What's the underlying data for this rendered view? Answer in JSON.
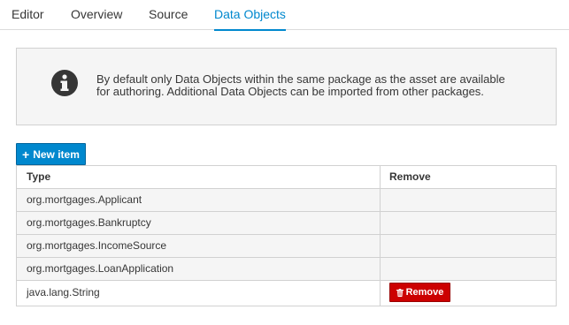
{
  "tabs": [
    {
      "label": "Editor",
      "active": false
    },
    {
      "label": "Overview",
      "active": false
    },
    {
      "label": "Source",
      "active": false
    },
    {
      "label": "Data Objects",
      "active": true
    }
  ],
  "info": {
    "icon": "info-circle-icon",
    "text_line1": "By default only Data Objects within the same package as the asset are available",
    "text_line2": "for authoring. Additional Data Objects can be imported from other packages."
  },
  "new_item_button": {
    "label": "New item",
    "icon": "plus-icon"
  },
  "table": {
    "columns": [
      "Type",
      "Remove"
    ],
    "rows": [
      {
        "type": "org.mortgages.Applicant",
        "removable": false
      },
      {
        "type": "org.mortgages.Bankruptcy",
        "removable": false
      },
      {
        "type": "org.mortgages.IncomeSource",
        "removable": false
      },
      {
        "type": "org.mortgages.LoanApplication",
        "removable": false
      },
      {
        "type": "java.lang.String",
        "removable": true
      }
    ],
    "remove_button_label": "Remove",
    "remove_icon": "trash-icon"
  },
  "colors": {
    "accent": "#0088ce",
    "danger": "#cc0000",
    "info_bg": "#f5f5f5"
  }
}
